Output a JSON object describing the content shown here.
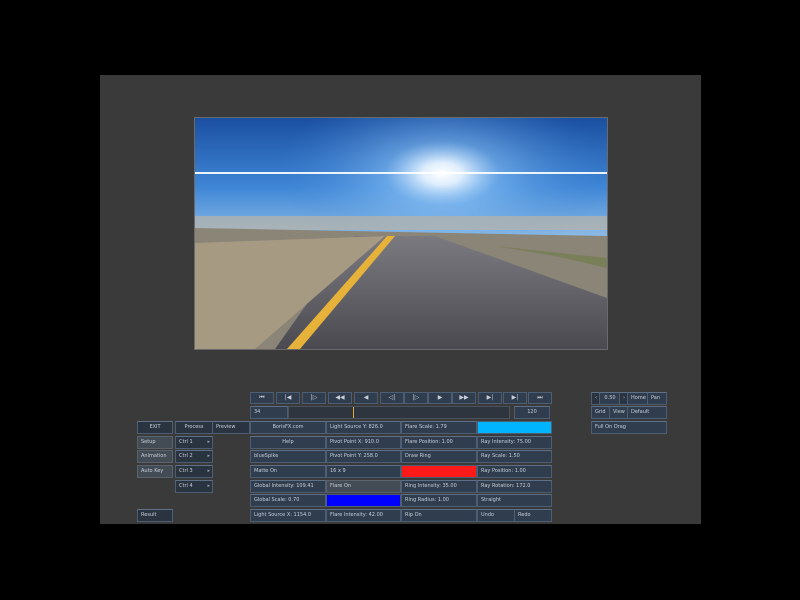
{
  "transport": [
    "⏮",
    "|◀",
    "|▷",
    "◀◀",
    "◀",
    "◁|",
    "|▷",
    "▶",
    "▶▶",
    "▶|",
    "▶|",
    "⏭"
  ],
  "timeline": {
    "start": "34",
    "end": "120",
    "playhead": 0.29
  },
  "left_menu": {
    "exit": "EXIT",
    "process": "Process",
    "preview": "Preview",
    "setup": "Setup",
    "animation": "Animation",
    "auto_key": "Auto Key",
    "ctrl1": "Ctrl 1",
    "ctrl2": "Ctrl 2",
    "ctrl3": "Ctrl 3",
    "ctrl4": "Ctrl 4",
    "result": "Result"
  },
  "col1": {
    "borisfx": "BorisFX.com",
    "help": "Help",
    "preset": "blueSpike",
    "matte": "Matte On",
    "global_intensity": "Global Intensity: 109.41",
    "global_scale": "Global Scale: 0.70",
    "light_source_x": "Light Source X: 1154.0"
  },
  "col2": {
    "light_source_y": "Light Source Y: 826.0",
    "pivot_x": "Pivot Point X: 910.0",
    "pivot_y": "Pivot Point Y: 258.0",
    "size": "16 x 9",
    "flare_on": "Flare On",
    "flare_intensity": "Flare Intensity: 42.00"
  },
  "col3": {
    "flare_scale": "Flare Scale: 1.79",
    "flare_position": "Flare Position: 1.00",
    "draw_ring": "Draw Ring",
    "ring_intensity": "Ring Intensity: 35.00",
    "ring_radius": "Ring Radius: 1.00",
    "rip_on": "Rip On"
  },
  "col4": {
    "ray_intensity": "Ray Intensity: 75.00",
    "ray_scale": "Ray Scale: 1.50",
    "ray_position": "Ray Position: 1.00",
    "ray_rotation": "Ray Rotation: 172.0",
    "straight": "Straight",
    "undo": "Undo",
    "redo": "Redo"
  },
  "colors": {
    "ray_color": "#00b4ff",
    "ring_color": "#ff1a1a",
    "flare_color": "#0000ff"
  },
  "right_panel": {
    "zoom": "0.50",
    "home": "Home",
    "pan": "Pan",
    "grid": "Grid",
    "view": "View",
    "default": "Default",
    "full_on_drag": "Full On Drag"
  }
}
